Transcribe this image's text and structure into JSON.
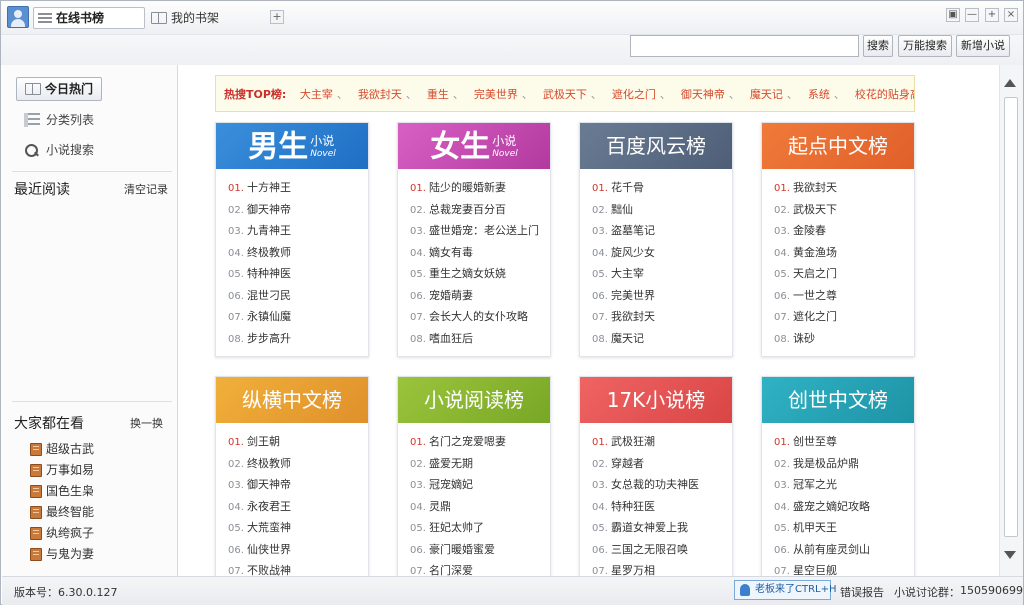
{
  "titlebar": {
    "tab_online": "在线书榜",
    "tab_shelf": "我的书架",
    "add_tab": "+",
    "win_buttons": [
      "▣",
      "—",
      "+",
      "×"
    ]
  },
  "toolbar": {
    "search_placeholder": "",
    "search_button": "搜索",
    "universal_search_button": "万能搜索",
    "new_novel_button": "新增小说"
  },
  "sidebar": {
    "today_hot": "今日热门",
    "category_list": "分类列表",
    "novel_search": "小说搜索",
    "recent_heading": "最近阅读",
    "clear_history": "清空记录",
    "popular_heading": "大家都在看",
    "refresh": "换一换",
    "popular_items": [
      "超级古武",
      "万事如易",
      "国色生枭",
      "最终智能",
      "纨绔疯子",
      "与鬼为妻"
    ]
  },
  "hot_bar": {
    "label": "热搜TOP榜:",
    "items": [
      "大主宰",
      "我欲封天",
      "重生",
      "完美世界",
      "武极天下",
      "遮化之门",
      "御天神帝",
      "魔天记",
      "系统",
      "校花的贴身高手"
    ]
  },
  "cards": [
    {
      "title": "男生",
      "title_small": "小说",
      "title_en": "Novel",
      "items": [
        "十方神王",
        "御天神帝",
        "九青神王",
        "终极教师",
        "特种神医",
        "混世刁民",
        "永镇仙魔",
        "步步高升"
      ]
    },
    {
      "title": "女生",
      "title_small": "小说",
      "title_en": "Novel",
      "items": [
        "陆少的暖婚新妻",
        "总裁宠妻百分百",
        "盛世婚宠：老公送上门",
        "嫡女有毒",
        "重生之嫡女妖娆",
        "宠婚萌妻",
        "会长大人的女仆攻略",
        "嗜血狂后"
      ]
    },
    {
      "title": "百度风云榜",
      "items": [
        "花千骨",
        "黜仙",
        "盗墓笔记",
        "旋风少女",
        "大主宰",
        "完美世界",
        "我欲封天",
        "魔天记"
      ]
    },
    {
      "title": "起点中文榜",
      "items": [
        "我欲封天",
        "武极天下",
        "金陵春",
        "黄金渔场",
        "天启之门",
        "一世之尊",
        "遮化之门",
        "诛砂"
      ]
    },
    {
      "title": "纵横中文榜",
      "items": [
        "剑王朝",
        "终极教师",
        "御天神帝",
        "永夜君王",
        "大荒蛮神",
        "仙侠世界",
        "不败战神"
      ]
    },
    {
      "title": "小说阅读榜",
      "items": [
        "名门之宠爱嗯妻",
        "盛爱无期",
        "冠宠嫡妃",
        "灵鼎",
        "狂妃太帅了",
        "豪门暖婚蜜爱",
        "名门深爱"
      ]
    },
    {
      "title": "17K小说榜",
      "items": [
        "武极狂潮",
        "穿越者",
        "女总裁的功夫神医",
        "特种狂医",
        "霸道女神爱上我",
        "三国之无限召唤",
        "星罗万相"
      ]
    },
    {
      "title": "创世中文榜",
      "items": [
        "创世至尊",
        "我是极品炉鼎",
        "冠军之光",
        "盛宠之嫡妃攻略",
        "机甲天王",
        "从前有座灵剑山",
        "星空巨舰"
      ]
    }
  ],
  "status": {
    "version": "版本号：6.30.0.127",
    "boss": "老板来了CTRL+H",
    "error_report": "错误报告",
    "group_label": "小说讨论群：",
    "group_number": "150590699"
  }
}
